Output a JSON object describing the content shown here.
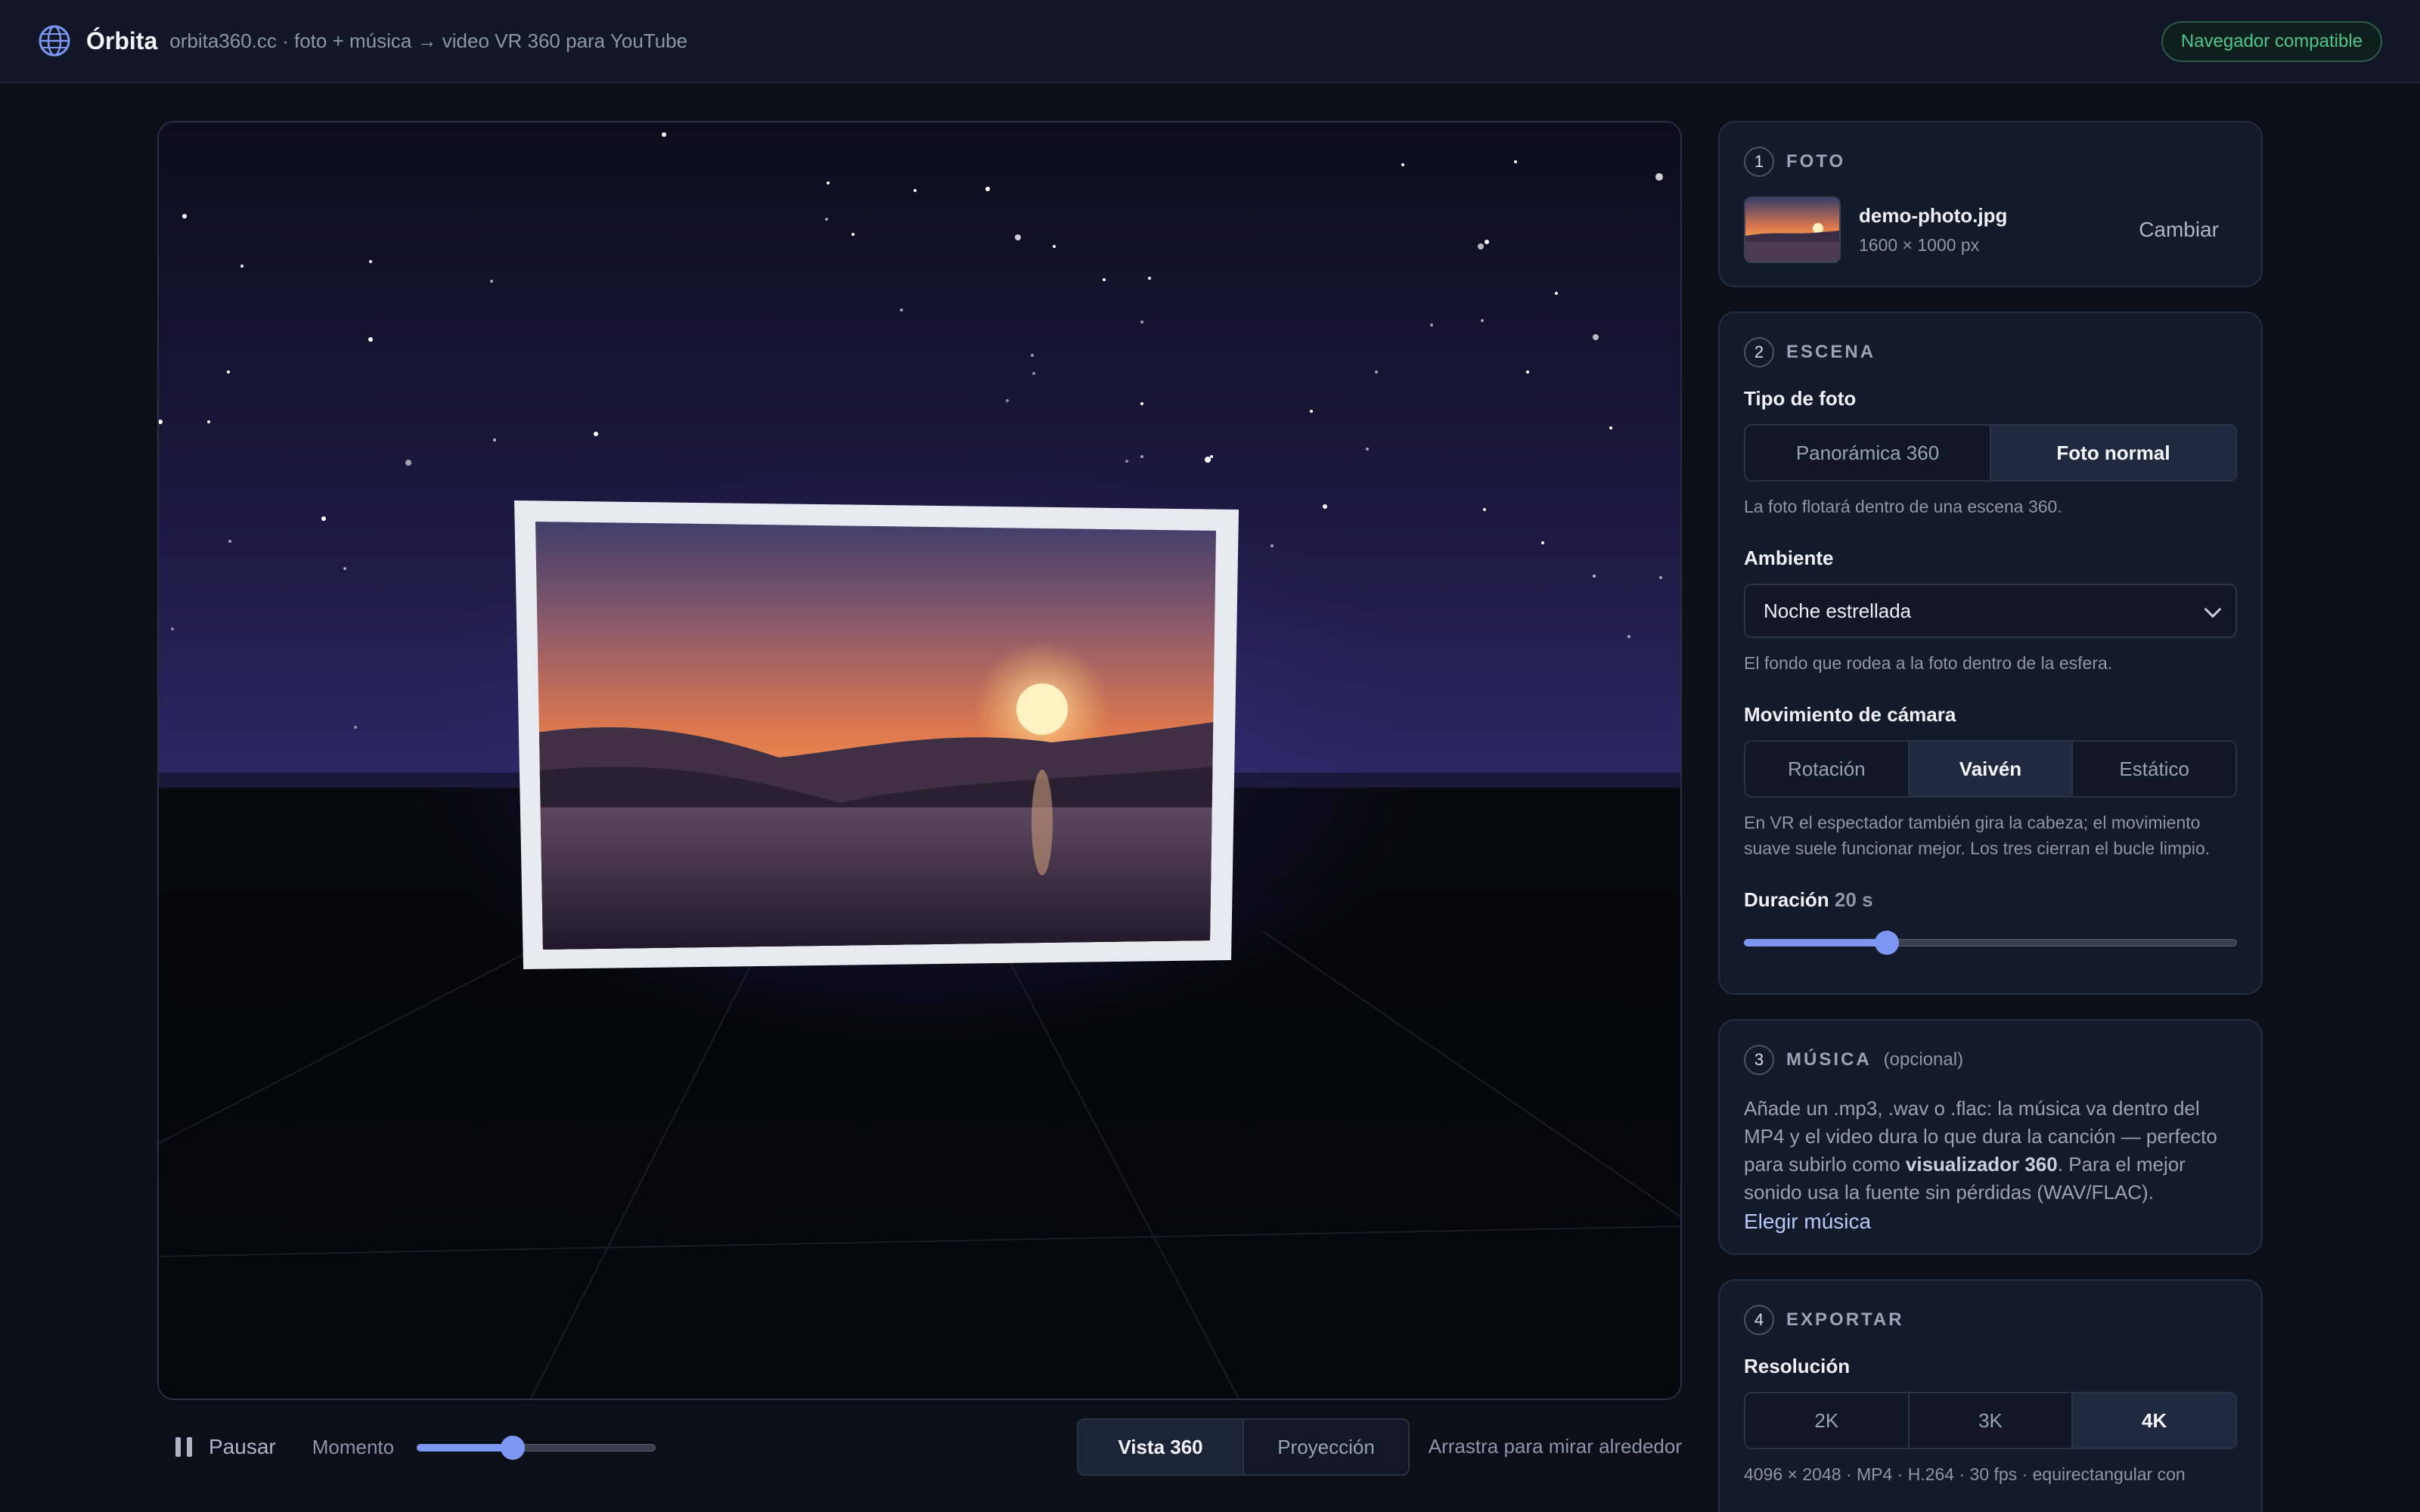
{
  "header": {
    "title": "Órbita",
    "subtitle": "orbita360.cc · foto + música → video VR 360 para YouTube",
    "badge": "Navegador compatible",
    "logo_icon": "globe-icon"
  },
  "controls": {
    "pause_label": "Pausar",
    "moment_label": "Momento",
    "moment_value": 0.4,
    "view_tabs": [
      "Vista 360",
      "Proyección"
    ],
    "active_view": "Vista 360",
    "drag_hint": "Arrastra para mirar alrededor"
  },
  "panel": {
    "photo": {
      "step": "1",
      "title": "FOTO",
      "file_name": "demo-photo.jpg",
      "file_dims": "1600 × 1000 px",
      "change_label": "Cambiar"
    },
    "scene": {
      "step": "2",
      "title": "ESCENA",
      "photo_type_label": "Tipo de foto",
      "photo_type_options": [
        "Panorámica 360",
        "Foto normal"
      ],
      "photo_type_selected": "Foto normal",
      "photo_type_hint": "La foto flotará dentro de una escena 360.",
      "ambient_label": "Ambiente",
      "ambient_value": "Noche estrellada",
      "ambient_hint": "El fondo que rodea a la foto dentro de la esfera.",
      "camera_label": "Movimiento de cámara",
      "camera_options": [
        "Rotación",
        "Vaivén",
        "Estático"
      ],
      "camera_selected": "Vaivén",
      "camera_hint": "En VR el espectador también gira la cabeza; el movimiento suave suele funcionar mejor. Los tres cierran el bucle limpio.",
      "duration_label": "Duración",
      "duration_value_text": "20 s",
      "duration_fraction": 0.29
    },
    "music": {
      "step": "3",
      "title": "MÚSICA",
      "optional": "(opcional)",
      "text_before": "Añade un .mp3, .wav o .flac: la música va dentro del MP4 y el video dura lo que dura la canción — perfecto para subirlo como ",
      "text_bold": "visualizador 360",
      "text_after": ". Para el mejor sonido usa la fuente sin pérdidas (WAV/FLAC).",
      "link": "Elegir música"
    },
    "export": {
      "step": "4",
      "title": "EXPORTAR",
      "resolution_label": "Resolución",
      "resolution_options": [
        "2K",
        "3K",
        "4K"
      ],
      "resolution_selected": "4K",
      "info": "4096 × 2048 · MP4 · H.264 · 30 fps · equirectangular con"
    }
  }
}
